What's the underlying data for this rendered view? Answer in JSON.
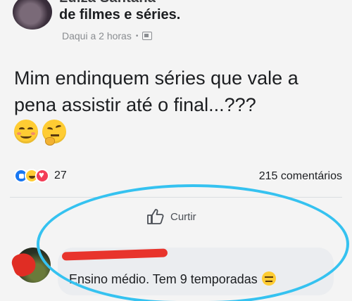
{
  "post": {
    "author_clipped": "Luiza Santana",
    "group_line": "de filmes e séries.",
    "time": "Daqui a 2 horas",
    "separator": "•",
    "text": "Mim endinquem séries que vale a pena assistir até o final...???",
    "emojis": [
      "smiling-face",
      "thinking-face"
    ]
  },
  "stats": {
    "reaction_count": "27",
    "comments_count": "215 comentários"
  },
  "actions": {
    "like_label": "Curtir"
  },
  "comment": {
    "author": "",
    "text": "Ensino médio. Tem 9 temporadas",
    "emoji": "expressionless-face"
  },
  "colors": {
    "like_blue": "#1877f2",
    "love_red": "#f33e58",
    "highlight": "#35c2f0",
    "redaction": "#e8342c"
  }
}
